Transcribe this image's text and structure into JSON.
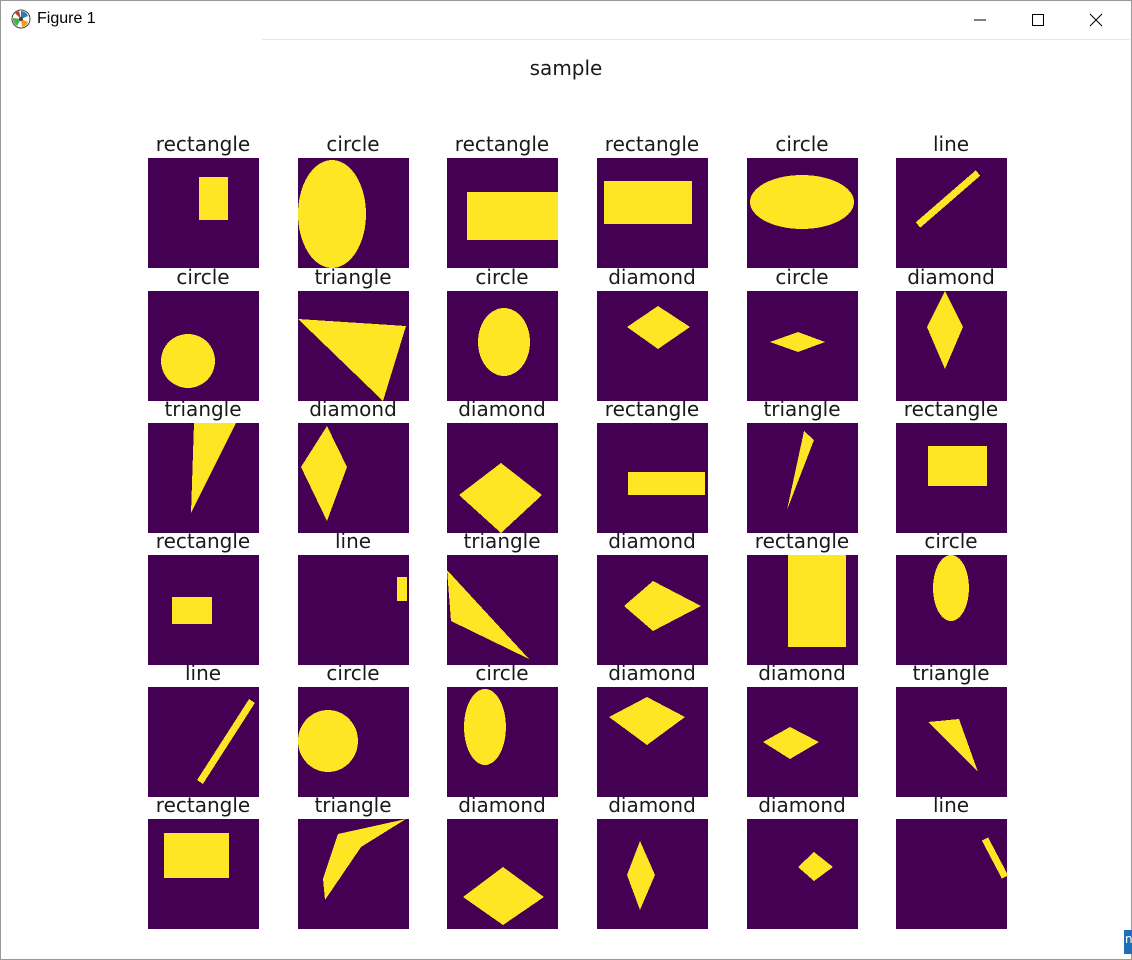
{
  "window": {
    "title": "Figure 1",
    "icon": "matplotlib-icon"
  },
  "window_controls": [
    "minimize-icon",
    "maximize-icon",
    "close-icon"
  ],
  "figure": {
    "title": "sample"
  },
  "colors": {
    "background_cell": "#440154",
    "shape": "#fde725"
  },
  "edge_glyph": "n",
  "grid": [
    [
      "rectangle",
      "circle",
      "rectangle",
      "rectangle",
      "circle",
      "line"
    ],
    [
      "circle",
      "triangle",
      "circle",
      "diamond",
      "circle",
      "diamond"
    ],
    [
      "triangle",
      "diamond",
      "diamond",
      "rectangle",
      "triangle",
      "rectangle"
    ],
    [
      "rectangle",
      "line",
      "triangle",
      "diamond",
      "rectangle",
      "circle"
    ],
    [
      "line",
      "circle",
      "circle",
      "diamond",
      "diamond",
      "triangle"
    ],
    [
      "rectangle",
      "triangle",
      "diamond",
      "diamond",
      "diamond",
      "line"
    ]
  ]
}
